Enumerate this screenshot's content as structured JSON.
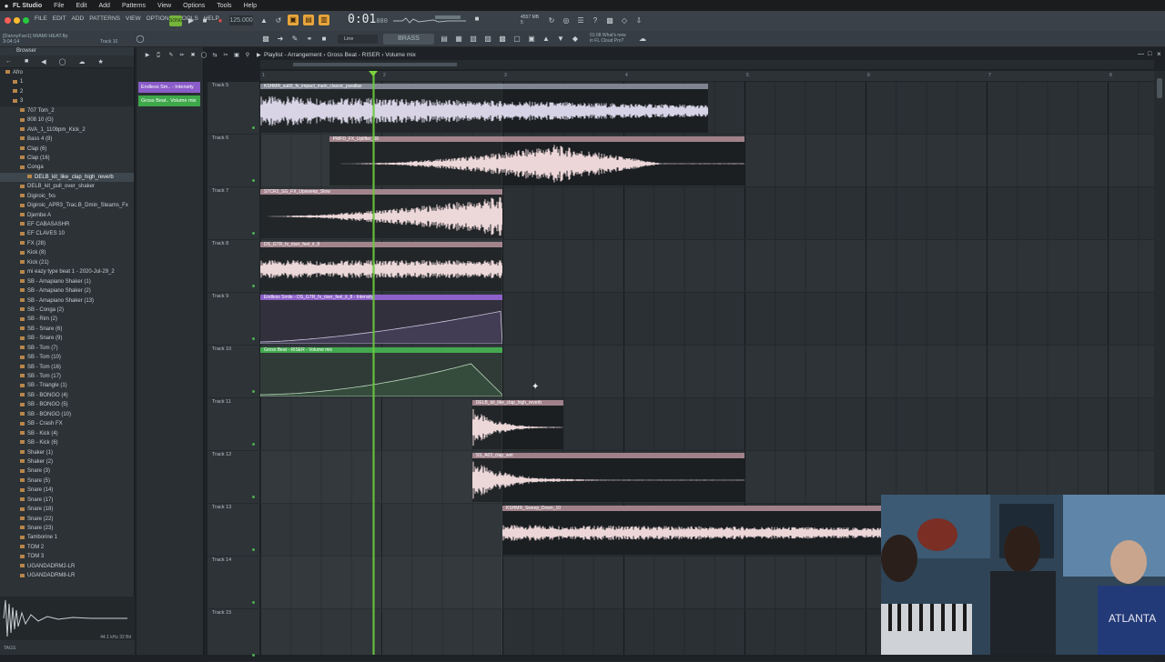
{
  "menubar": {
    "app": "FL Studio",
    "items": [
      "File",
      "Edit",
      "Add",
      "Patterns",
      "View",
      "Options",
      "Tools",
      "Help"
    ]
  },
  "fl_menu": [
    "FILE",
    "EDIT",
    "ADD",
    "PATTERNS",
    "VIEW",
    "OPTIONS",
    "TOOLS",
    "HELP"
  ],
  "song": {
    "title": "[DannyFan1] MIAMI HEAT.flp",
    "time": "3:04:14",
    "track_label": "Track 10"
  },
  "transport": {
    "tempo": "125.000",
    "time": "0:01",
    "time_small": "880",
    "mode": "SONG"
  },
  "cpu": {
    "line1": "4557 MB",
    "line2": "5"
  },
  "snap": "Line",
  "pattern": "BRASS",
  "news": {
    "line1": "01:08 What's new",
    "line2": "in FL Cloud Pro?"
  },
  "browser": {
    "title": "Browser",
    "items": [
      {
        "label": "Afro",
        "indent": 1,
        "style": "dark"
      },
      {
        "label": "1",
        "indent": 2,
        "style": "dark"
      },
      {
        "label": "2",
        "indent": 2,
        "style": "dark"
      },
      {
        "label": "3",
        "indent": 2,
        "style": "dark"
      },
      {
        "label": "707 Tom_2",
        "indent": 3
      },
      {
        "label": "808 10 (G)",
        "indent": 3
      },
      {
        "label": "AVA_1_110bpm_Kick_2",
        "indent": 3
      },
      {
        "label": "Bass 4 (8)",
        "indent": 3
      },
      {
        "label": "Clap  (6)",
        "indent": 3
      },
      {
        "label": "Clap  (16)",
        "indent": 3
      },
      {
        "label": "Conga",
        "indent": 3
      },
      {
        "label": "DELB_kit_like_clap_high_reverb",
        "indent": 4,
        "style": "sel"
      },
      {
        "label": "DELB_kit_pull_over_shaker",
        "indent": 3
      },
      {
        "label": "Digiroic_fxs",
        "indent": 3
      },
      {
        "label": "Digiroic_APR3_Trac.B_Dmin_Steams_Fx",
        "indent": 3
      },
      {
        "label": "Djembe A",
        "indent": 3
      },
      {
        "label": "EF CABASASHR",
        "indent": 3
      },
      {
        "label": "EF CLAVES 10",
        "indent": 3
      },
      {
        "label": "FX  (28)",
        "indent": 3
      },
      {
        "label": "Kick  (8)",
        "indent": 3
      },
      {
        "label": "Kick  (21)",
        "indent": 3
      },
      {
        "label": "mi eazy type beat 1 - 2020-Jul-29_2",
        "indent": 3
      },
      {
        "label": "SB - Amapiano Shaker (1)",
        "indent": 3
      },
      {
        "label": "SB - Amapiano Shaker (2)",
        "indent": 3
      },
      {
        "label": "SB - Amapiano Shaker (13)",
        "indent": 3
      },
      {
        "label": "SB - Conga  (2)",
        "indent": 3
      },
      {
        "label": "SB - Rim  (2)",
        "indent": 3
      },
      {
        "label": "SB - Snare (6)",
        "indent": 3
      },
      {
        "label": "SB - Snare (9)",
        "indent": 3
      },
      {
        "label": "SB - Tom  (7)",
        "indent": 3
      },
      {
        "label": "SB - Tom  (10)",
        "indent": 3
      },
      {
        "label": "SB - Tom  (16)",
        "indent": 3
      },
      {
        "label": "SB - Tom  (17)",
        "indent": 3
      },
      {
        "label": "SB - Triangle (1)",
        "indent": 3
      },
      {
        "label": "SB - BONGO (4)",
        "indent": 3
      },
      {
        "label": "SB - BONGO (5)",
        "indent": 3
      },
      {
        "label": "SB - BONGO (10)",
        "indent": 3
      },
      {
        "label": "SB - Crash FX",
        "indent": 3
      },
      {
        "label": "SB - Kick (4)",
        "indent": 3
      },
      {
        "label": "SB - Kick (6)",
        "indent": 3
      },
      {
        "label": "Shaker  (1)",
        "indent": 3
      },
      {
        "label": "Shaker  (2)",
        "indent": 3
      },
      {
        "label": "Snare  (3)",
        "indent": 3
      },
      {
        "label": "Snare  (5)",
        "indent": 3
      },
      {
        "label": "Snare  (14)",
        "indent": 3
      },
      {
        "label": "Snare  (17)",
        "indent": 3
      },
      {
        "label": "Snare  (18)",
        "indent": 3
      },
      {
        "label": "Snare  (22)",
        "indent": 3
      },
      {
        "label": "Snare  (23)",
        "indent": 3
      },
      {
        "label": "Tamborine 1",
        "indent": 3
      },
      {
        "label": "TOM 2",
        "indent": 3
      },
      {
        "label": "TOM 3",
        "indent": 3
      },
      {
        "label": "UGANDADRM2-LR",
        "indent": 3
      },
      {
        "label": "UGANDADRM8-LR",
        "indent": 3
      }
    ],
    "footer_left": "TAGS",
    "footer_right": "44.1 kHz 32 Bit"
  },
  "channel_clips": [
    {
      "label": "Endless Sm.. - Intensity",
      "color": "#8a5cc8"
    },
    {
      "label": "Gross Beat.. Volume mix",
      "color": "#3ea84a"
    }
  ],
  "playlist": {
    "title": "Playlist - Arrangement › Gross Beat - RISER › Volume mix",
    "tracks": [
      "Track 5",
      "Track 6",
      "Track 7",
      "Track 8",
      "Track 9",
      "Track 10",
      "Track 11",
      "Track 12",
      "Track 13",
      "Track 14",
      "Track 15"
    ],
    "clips": [
      {
        "track": 0,
        "start": 0.0,
        "end": 3.7,
        "label": "KSHMR_sub5_fx_impact_main_classic_parallax",
        "kind": "audio-noise",
        "title_color": "#7e8590"
      },
      {
        "track": 1,
        "start": 0.57,
        "end": 4.0,
        "label": "PMFD_FX_Uplifter_06",
        "kind": "audio-riser-mid",
        "title_color": "#a0818a"
      },
      {
        "track": 2,
        "start": 0.0,
        "end": 2.0,
        "label": "STCR2_SG_FX_Upsweep_Slow",
        "kind": "audio-riser",
        "title_color": "#a0818a"
      },
      {
        "track": 3,
        "start": 0.0,
        "end": 2.0,
        "label": "DS_GTR_fx_riser_feel_it_8",
        "kind": "audio-noise-flat",
        "title_color": "#a0818a"
      },
      {
        "track": 4,
        "start": 0.0,
        "end": 2.0,
        "label": "Endless Smile - DS_GTR_fx_riser_feel_it_8 - Intensity",
        "kind": "automation-rise",
        "title_color": "#8a5cc8"
      },
      {
        "track": 5,
        "start": 0.0,
        "end": 2.0,
        "label": "Gross Beat - RISER - Volume mix",
        "kind": "automation-peak",
        "title_color": "#3ea84a"
      },
      {
        "track": 6,
        "start": 1.75,
        "end": 2.5,
        "label": "DELB_kit_like_clap_high_reverb",
        "kind": "audio-hit",
        "title_color": "#a0818a"
      },
      {
        "track": 7,
        "start": 1.75,
        "end": 4.0,
        "label": "SS_A03_clap_wet",
        "kind": "audio-hit-long",
        "title_color": "#a0818a"
      },
      {
        "track": 8,
        "start": 2.0,
        "end": 5.5,
        "label": "KSHMR_Sweep_Down_10",
        "kind": "audio-sweep",
        "title_color": "#a0818a"
      }
    ],
    "ruler_marks": [
      "1",
      "2",
      "3",
      "4",
      "5",
      "6",
      "7",
      "8"
    ]
  }
}
